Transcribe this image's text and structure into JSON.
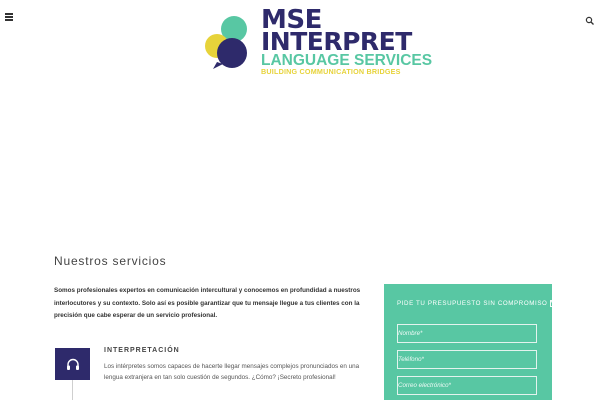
{
  "header": {
    "menu_icon": "hamburger-menu-icon",
    "search_icon": "search-icon",
    "logo": {
      "line1": "MSE",
      "line2": "INTERPRET",
      "line3": "LANGUAGE SERVICES",
      "tagline": "BUILDING COMMUNICATION BRIDGES",
      "colors": {
        "navy": "#2e2a6b",
        "teal": "#58c7a3",
        "yellow": "#e7d33a"
      }
    }
  },
  "main": {
    "section_title": "Nuestros servicios",
    "intro": "Somos profesionales expertos en comunicación intercultural y conocemos en profundidad a nuestros interlocutores y su contexto. Solo así es posible garantizar que tu mensaje llegue a tus clientes con la precisión que cabe esperar de un servicio profesional.",
    "service": {
      "icon": "headphones-icon",
      "title": "INTERPRETACIÓN",
      "description": "Los intérpretes somos capaces de hacerte llegar mensajes complejos pronunciados en una lengua extranjera en tan solo cuestión de segundos. ¿Cómo? ¡Secreto profesional!"
    }
  },
  "quote_form": {
    "title": "PIDE TU PRESUPUESTO SIN COMPROMISO",
    "title_icon": "envelope-icon",
    "fields": {
      "name_placeholder": "Nombre*",
      "phone_placeholder": "Teléfono*",
      "email_placeholder": "Correo electrónico*"
    },
    "colors": {
      "background": "#58c7a3",
      "icon_box": "#2e2a6b"
    }
  }
}
